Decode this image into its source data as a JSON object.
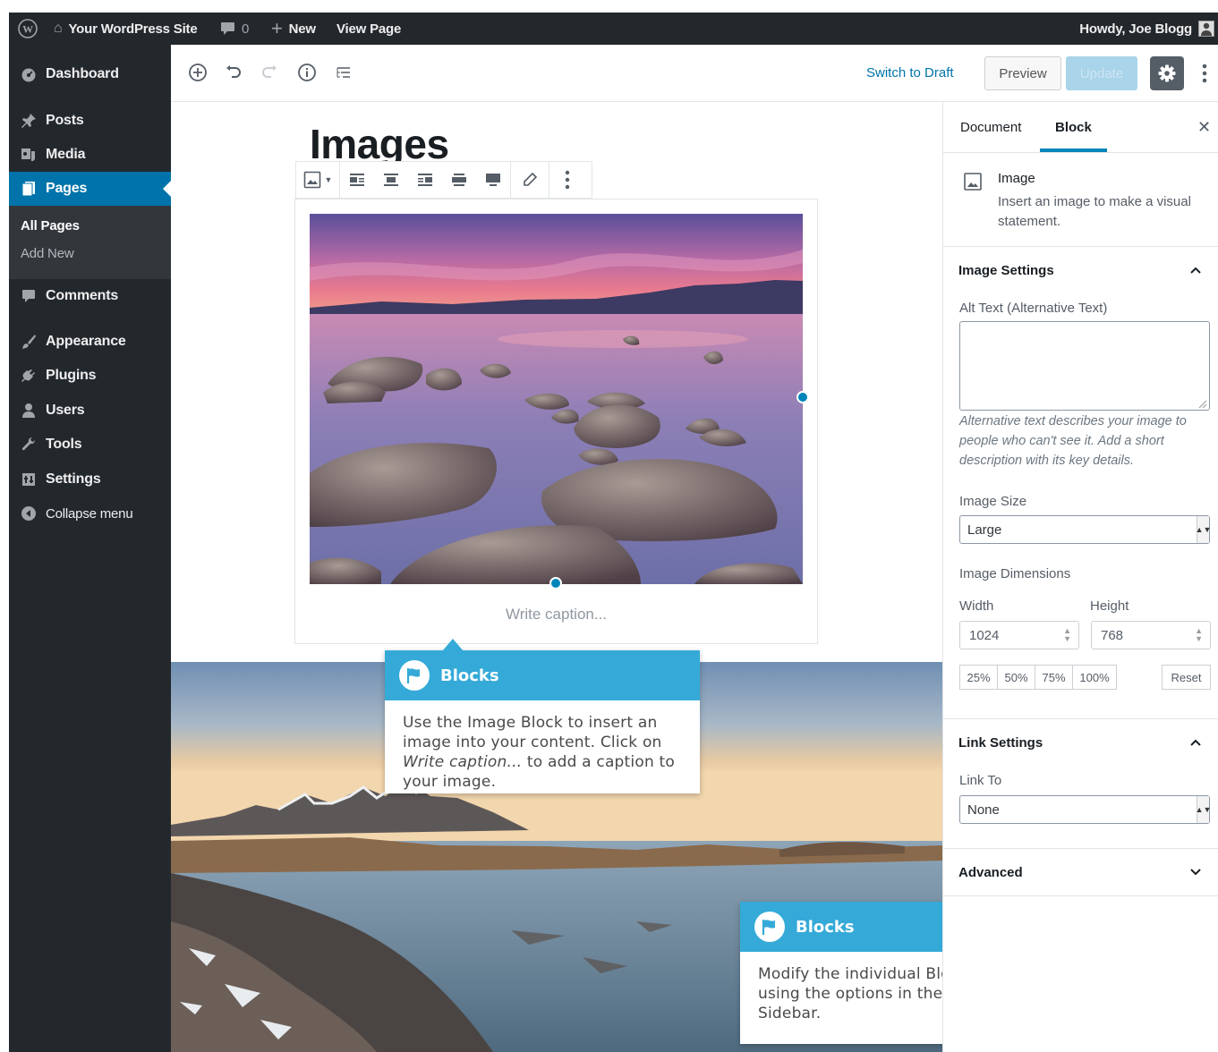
{
  "admin_bar": {
    "site_name": "Your WordPress Site",
    "comments_count": "0",
    "new_label": "New",
    "view_page": "View Page",
    "howdy": "Howdy, Joe Blogg"
  },
  "sidebar": {
    "items": [
      {
        "label": "Dashboard",
        "icon": "dashboard-icon"
      },
      {
        "label": "Posts",
        "icon": "pin-icon"
      },
      {
        "label": "Media",
        "icon": "media-icon"
      },
      {
        "label": "Pages",
        "icon": "pages-icon"
      },
      {
        "label": "Comments",
        "icon": "comment-icon"
      },
      {
        "label": "Appearance",
        "icon": "brush-icon"
      },
      {
        "label": "Plugins",
        "icon": "plug-icon"
      },
      {
        "label": "Users",
        "icon": "user-icon"
      },
      {
        "label": "Tools",
        "icon": "wrench-icon"
      },
      {
        "label": "Settings",
        "icon": "settings-icon"
      },
      {
        "label": "Collapse menu",
        "icon": "collapse-icon"
      }
    ],
    "sub_items": [
      "All Pages",
      "Add New"
    ]
  },
  "header": {
    "switch_to_draft": "Switch to Draft",
    "preview": "Preview",
    "update": "Update"
  },
  "content": {
    "title": "Images",
    "caption_placeholder": "Write caption..."
  },
  "callouts": [
    {
      "title": "Blocks",
      "text_1": "Use the Image Block to insert an image into your content. Click on ",
      "text_em": "Write caption...",
      "text_2": " to add a caption to your image."
    },
    {
      "title": "Blocks",
      "text": "Modify the individual Block Settings using the options in the Settings Sidebar."
    }
  ],
  "settings_sidebar": {
    "tabs": [
      "Document",
      "Block"
    ],
    "active_tab": "Block",
    "block_name": "Image",
    "block_description": "Insert an image to make a visual statement.",
    "image_settings_title": "Image Settings",
    "alt_text_label": "Alt Text (Alternative Text)",
    "alt_text_value": "",
    "alt_help": "Alternative text describes your image to people who can't see it. Add a short description with its key details.",
    "image_size_label": "Image Size",
    "image_size_value": "Large",
    "image_dimensions_label": "Image Dimensions",
    "width_label": "Width",
    "height_label": "Height",
    "width_value": "1024",
    "height_value": "768",
    "percent_buttons": [
      "25%",
      "50%",
      "75%",
      "100%"
    ],
    "reset": "Reset",
    "link_settings_title": "Link Settings",
    "link_to_label": "Link To",
    "link_to_value": "None",
    "advanced_title": "Advanced"
  },
  "colors": {
    "accent": "#0073aa",
    "admin_dark": "#23282d",
    "callout_header": "#35aad8",
    "update_disabled": "#a9d4ea"
  }
}
